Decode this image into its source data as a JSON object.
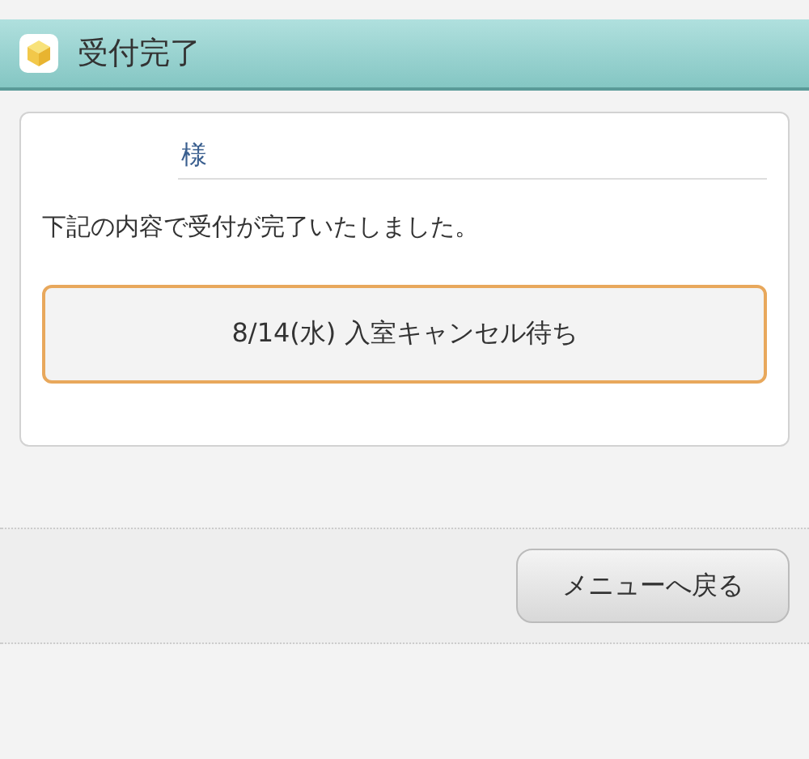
{
  "header": {
    "title": "受付完了"
  },
  "card": {
    "name_suffix": "様",
    "message": "下記の内容で受付が完了いたしました。",
    "reservation": "8/14(水) 入室キャンセル待ち"
  },
  "footer": {
    "back_button": "メニューへ戻る"
  }
}
